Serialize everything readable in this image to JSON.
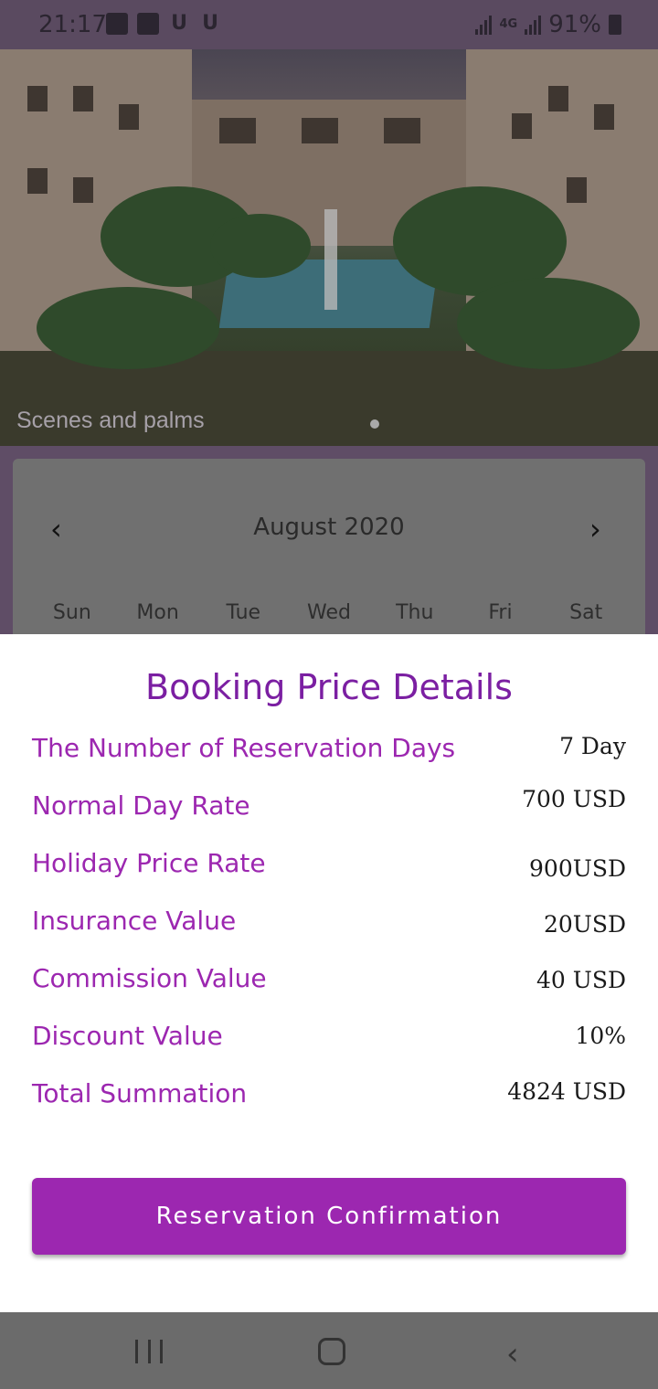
{
  "status_bar": {
    "time": "21:17",
    "network": "4G",
    "battery": "91%"
  },
  "hero": {
    "caption": "Scenes and palms"
  },
  "calendar": {
    "month": "August 2020",
    "prev_icon": "‹",
    "next_icon": "›",
    "weekdays": [
      "Sun",
      "Mon",
      "Tue",
      "Wed",
      "Thu",
      "Fri",
      "Sat"
    ]
  },
  "booking": {
    "title": "Booking Price Details",
    "rows": [
      {
        "label": "The Number of Reservation Days",
        "value": "7 Day"
      },
      {
        "label": "Normal Day Rate",
        "value": "700 USD"
      },
      {
        "label": "Holiday Price Rate",
        "value": "900USD"
      },
      {
        "label": "Insurance Value",
        "value": "20USD"
      },
      {
        "label": "Commission Value",
        "value": "40 USD"
      },
      {
        "label": "Discount Value",
        "value": "10%"
      },
      {
        "label": "Total Summation",
        "value": "4824 USD"
      }
    ],
    "confirm_label": "Reservation Confirmation"
  },
  "colors": {
    "accent": "#9c27b0",
    "title": "#7b1fa2"
  },
  "icons": {
    "gallery": "image-icon",
    "wifi": "wifi-icon",
    "nav_recent": "recent-apps-icon",
    "nav_home": "home-icon",
    "nav_back": "back-icon"
  }
}
